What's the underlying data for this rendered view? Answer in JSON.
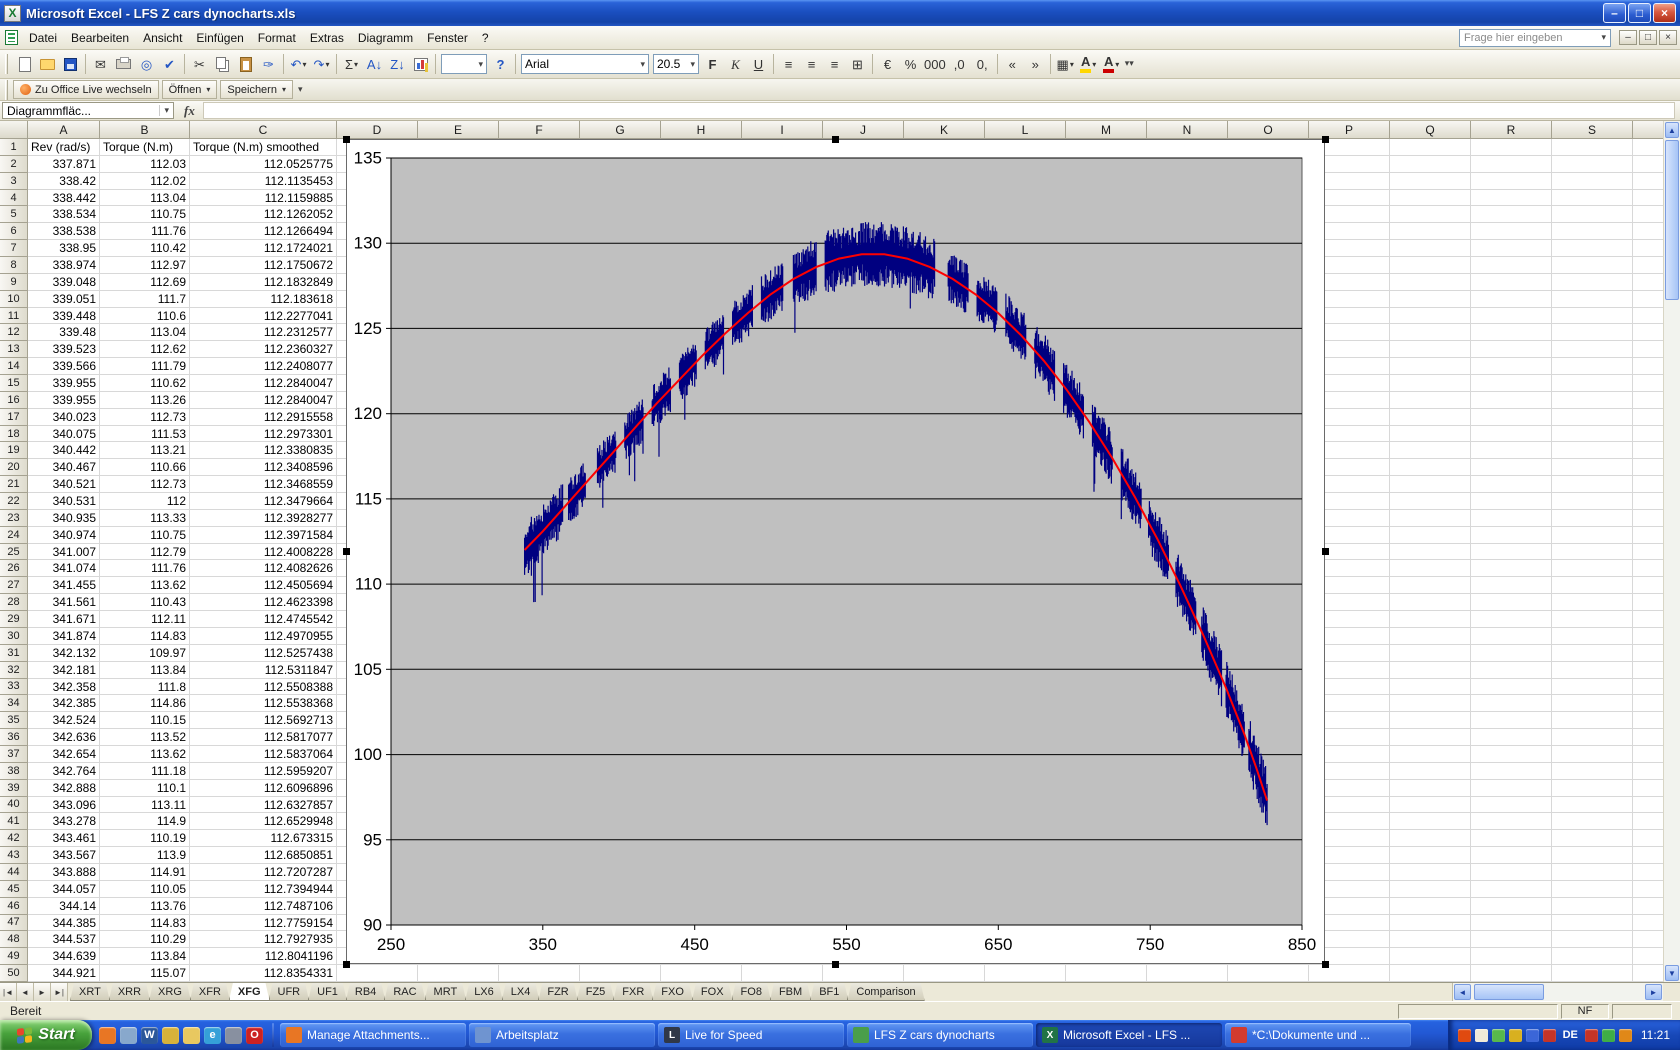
{
  "window": {
    "title": "Microsoft Excel - LFS Z cars dynocharts.xls",
    "min": "–",
    "max": "□",
    "close": "×"
  },
  "icons": {
    "excel_x": "X"
  },
  "ui": {
    "dd": "▾",
    "up": "▲",
    "down": "▼",
    "left": "◄",
    "right": "►"
  },
  "menu": {
    "items": [
      "Datei",
      "Bearbeiten",
      "Ansicht",
      "Einfügen",
      "Format",
      "Extras",
      "Diagramm",
      "Fenster",
      "?"
    ],
    "question_box": "Frage hier eingeben"
  },
  "toolbar_std": [
    {
      "name": "new-icon",
      "kind": "page"
    },
    {
      "name": "open-icon",
      "kind": "folder"
    },
    {
      "name": "save-icon",
      "kind": "disk"
    },
    {
      "sep": true
    },
    {
      "name": "email-icon",
      "glyph": "✉"
    },
    {
      "name": "print-icon",
      "kind": "print"
    },
    {
      "name": "print-preview-icon",
      "glyph": "◎",
      "cls": "c-blue"
    },
    {
      "name": "spelling-icon",
      "glyph": "✔",
      "cls": "c-blue"
    },
    {
      "sep": true
    },
    {
      "name": "cut-icon",
      "glyph": "✂"
    },
    {
      "name": "copy-icon",
      "kind": "copy"
    },
    {
      "name": "paste-icon",
      "kind": "paste"
    },
    {
      "name": "format-painter-icon",
      "glyph": "✑",
      "cls": "c-blue"
    },
    {
      "sep": true
    },
    {
      "name": "undo-icon",
      "glyph": "↶",
      "cls": "c-blue",
      "dd": true
    },
    {
      "name": "redo-icon",
      "glyph": "↷",
      "cls": "c-blue",
      "dd": true
    },
    {
      "sep": true
    },
    {
      "name": "autosum-icon",
      "glyph": "Σ",
      "dd": true
    },
    {
      "name": "sort-ascending-icon",
      "glyph": "A↓",
      "cls": "c-blue"
    },
    {
      "name": "sort-descending-icon",
      "glyph": "Z↓",
      "cls": "c-blue"
    },
    {
      "name": "chart-wizard-icon",
      "kind": "chart"
    },
    {
      "sep": true
    },
    {
      "name": "zoom-combo",
      "combo": ""
    },
    {
      "name": "help-icon",
      "glyph": "?",
      "cls": "c-blue s-b"
    }
  ],
  "toolbar_fmt": {
    "font_name": "Arial",
    "font_size": "20.5",
    "buttons": [
      {
        "name": "bold-button",
        "glyph": "F",
        "cls": "s-b"
      },
      {
        "name": "italic-button",
        "glyph": "K",
        "cls": "s-i"
      },
      {
        "name": "underline-button",
        "glyph": "U",
        "cls": "s-u"
      },
      {
        "sep": true
      },
      {
        "name": "align-left-icon",
        "glyph": "≡"
      },
      {
        "name": "align-center-icon",
        "glyph": "≡"
      },
      {
        "name": "align-right-icon",
        "glyph": "≡"
      },
      {
        "name": "merge-center-icon",
        "glyph": "⊞"
      },
      {
        "sep": true
      },
      {
        "name": "currency-icon",
        "glyph": "€"
      },
      {
        "name": "percent-icon",
        "glyph": "%"
      },
      {
        "name": "thousands-icon",
        "glyph": "000"
      },
      {
        "name": "increase-decimal-icon",
        "glyph": ",0"
      },
      {
        "name": "decrease-decimal-icon",
        "glyph": "0,"
      },
      {
        "sep": true
      },
      {
        "name": "decrease-indent-icon",
        "glyph": "«"
      },
      {
        "name": "increase-indent-icon",
        "glyph": "»"
      },
      {
        "sep": true
      },
      {
        "name": "borders-icon",
        "glyph": "▦",
        "dd": true
      },
      {
        "name": "fill-color-icon",
        "glyph": "A",
        "chip": "#ffd700",
        "dd": true
      },
      {
        "name": "font-color-icon",
        "glyph": "A",
        "chip": "#cc0000",
        "dd": true
      }
    ]
  },
  "office_bar": {
    "items": [
      {
        "name": "office-live-button",
        "label": "Zu Office Live wechseln",
        "icon": true
      },
      {
        "name": "open-menu-button",
        "label": "Öffnen",
        "dd": true
      },
      {
        "name": "save-menu-button",
        "label": "Speichern",
        "dd": true
      }
    ]
  },
  "formula_bar": {
    "name_box": "Diagrammfläc...",
    "fx": "fx",
    "formula": ""
  },
  "sheet": {
    "columns": [
      "A",
      "B",
      "C",
      "D",
      "E",
      "F",
      "G",
      "H",
      "I",
      "J",
      "K",
      "L",
      "M",
      "N",
      "O",
      "P",
      "Q",
      "R",
      "S"
    ],
    "first_row": [
      "Rev (rad/s)",
      "Torque (N.m)",
      "Torque (N.m) smoothed"
    ],
    "rows": [
      [
        "337.871",
        "112.03",
        "112.0525775"
      ],
      [
        "338.42",
        "112.02",
        "112.1135453"
      ],
      [
        "338.442",
        "113.04",
        "112.1159885"
      ],
      [
        "338.534",
        "110.75",
        "112.1262052"
      ],
      [
        "338.538",
        "111.76",
        "112.1266494"
      ],
      [
        "338.95",
        "110.42",
        "112.1724021"
      ],
      [
        "338.974",
        "112.97",
        "112.1750672"
      ],
      [
        "339.048",
        "112.69",
        "112.1832849"
      ],
      [
        "339.051",
        "111.7",
        "112.183618"
      ],
      [
        "339.448",
        "110.6",
        "112.2277041"
      ],
      [
        "339.48",
        "113.04",
        "112.2312577"
      ],
      [
        "339.523",
        "112.62",
        "112.2360327"
      ],
      [
        "339.566",
        "111.79",
        "112.2408077"
      ],
      [
        "339.955",
        "110.62",
        "112.2840047"
      ],
      [
        "339.955",
        "113.26",
        "112.2840047"
      ],
      [
        "340.023",
        "112.73",
        "112.2915558"
      ],
      [
        "340.075",
        "111.53",
        "112.2973301"
      ],
      [
        "340.442",
        "113.21",
        "112.3380835"
      ],
      [
        "340.467",
        "110.66",
        "112.3408596"
      ],
      [
        "340.521",
        "112.73",
        "112.3468559"
      ],
      [
        "340.531",
        "112",
        "112.3479664"
      ],
      [
        "340.935",
        "113.33",
        "112.3928277"
      ],
      [
        "340.974",
        "110.75",
        "112.3971584"
      ],
      [
        "341.007",
        "112.79",
        "112.4008228"
      ],
      [
        "341.074",
        "111.76",
        "112.4082626"
      ],
      [
        "341.455",
        "113.62",
        "112.4505694"
      ],
      [
        "341.561",
        "110.43",
        "112.4623398"
      ],
      [
        "341.671",
        "112.11",
        "112.4745542"
      ],
      [
        "341.874",
        "114.83",
        "112.4970955"
      ],
      [
        "342.132",
        "109.97",
        "112.5257438"
      ],
      [
        "342.181",
        "113.84",
        "112.5311847"
      ],
      [
        "342.358",
        "111.8",
        "112.5508388"
      ],
      [
        "342.385",
        "114.86",
        "112.5538368"
      ],
      [
        "342.524",
        "110.15",
        "112.5692713"
      ],
      [
        "342.636",
        "113.52",
        "112.5817077"
      ],
      [
        "342.654",
        "113.62",
        "112.5837064"
      ],
      [
        "342.764",
        "111.18",
        "112.5959207"
      ],
      [
        "342.888",
        "110.1",
        "112.6096896"
      ],
      [
        "343.096",
        "113.11",
        "112.6327857"
      ],
      [
        "343.278",
        "114.9",
        "112.6529948"
      ],
      [
        "343.461",
        "110.19",
        "112.673315"
      ],
      [
        "343.567",
        "113.9",
        "112.6850851"
      ],
      [
        "343.888",
        "114.91",
        "112.7207287"
      ],
      [
        "344.057",
        "110.05",
        "112.7394944"
      ],
      [
        "344.14",
        "113.76",
        "112.7487106"
      ],
      [
        "344.385",
        "114.83",
        "112.7759154"
      ],
      [
        "344.537",
        "110.29",
        "112.7927935"
      ],
      [
        "344.639",
        "113.84",
        "112.8041196"
      ],
      [
        "344.921",
        "115.07",
        "112.8354331"
      ]
    ]
  },
  "chart_data": {
    "type": "scatter",
    "title": "",
    "xlabel": "",
    "ylabel": "",
    "xlim": [
      250,
      850
    ],
    "ylim": [
      90,
      135
    ],
    "x_ticks": [
      250,
      350,
      450,
      550,
      650,
      750,
      850
    ],
    "y_ticks": [
      90,
      95,
      100,
      105,
      110,
      115,
      120,
      125,
      130,
      135
    ],
    "plot_bg": "#c0c0c0",
    "grid": true,
    "legend": false,
    "series": [
      {
        "name": "Torque (N.m)",
        "color": "#000080",
        "style": "noisy-vertical-bursts",
        "clusters": [
          [
            338,
            363,
            1.6
          ],
          [
            367,
            378,
            1.4
          ],
          [
            386,
            398,
            1.4
          ],
          [
            404,
            416,
            1.4
          ],
          [
            422,
            434,
            1.4
          ],
          [
            440,
            451,
            1.4
          ],
          [
            457,
            469,
            1.4
          ],
          [
            475,
            488,
            1.5
          ],
          [
            494,
            508,
            1.5
          ],
          [
            515,
            530,
            1.7
          ],
          [
            536,
            608,
            1.9
          ],
          [
            617,
            630,
            1.5
          ],
          [
            636,
            649,
            1.5
          ],
          [
            655,
            668,
            1.6
          ],
          [
            674,
            687,
            1.6
          ],
          [
            693,
            706,
            1.6
          ],
          [
            712,
            725,
            1.6
          ],
          [
            731,
            744,
            1.6
          ],
          [
            749,
            762,
            1.6
          ],
          [
            767,
            780,
            1.7
          ],
          [
            784,
            797,
            1.7
          ],
          [
            800,
            812,
            1.7
          ],
          [
            815,
            827,
            1.8
          ]
        ]
      },
      {
        "name": "Torque (N.m) smoothed",
        "color": "#ff0000",
        "style": "smooth-line",
        "points": [
          [
            338,
            112.0
          ],
          [
            350,
            113.1
          ],
          [
            365,
            114.6
          ],
          [
            380,
            116.1
          ],
          [
            395,
            117.6
          ],
          [
            410,
            119.1
          ],
          [
            425,
            120.6
          ],
          [
            440,
            122.0
          ],
          [
            455,
            123.4
          ],
          [
            470,
            124.7
          ],
          [
            485,
            125.9
          ],
          [
            500,
            127.0
          ],
          [
            515,
            127.9
          ],
          [
            530,
            128.6
          ],
          [
            545,
            129.1
          ],
          [
            560,
            129.35
          ],
          [
            575,
            129.35
          ],
          [
            590,
            129.1
          ],
          [
            605,
            128.6
          ],
          [
            620,
            127.9
          ],
          [
            635,
            127.0
          ],
          [
            650,
            125.9
          ],
          [
            665,
            124.6
          ],
          [
            680,
            123.1
          ],
          [
            695,
            121.4
          ],
          [
            710,
            119.5
          ],
          [
            725,
            117.4
          ],
          [
            740,
            115.1
          ],
          [
            755,
            112.6
          ],
          [
            770,
            109.9
          ],
          [
            785,
            107.0
          ],
          [
            800,
            103.9
          ],
          [
            812,
            101.2
          ],
          [
            820,
            99.2
          ],
          [
            827,
            97.3
          ]
        ]
      }
    ]
  },
  "tabs": {
    "nav": [
      "|◄",
      "◄",
      "►",
      "►|"
    ],
    "sheets": [
      "XRT",
      "XRR",
      "XRG",
      "XFR",
      "XFG",
      "UFR",
      "UF1",
      "RB4",
      "RAC",
      "MRT",
      "LX6",
      "LX4",
      "FZR",
      "FZ5",
      "FXR",
      "FXO",
      "FOX",
      "FO8",
      "FBM",
      "BF1",
      "Comparison"
    ],
    "active": "XFG"
  },
  "status_bar": {
    "left": "Bereit",
    "right": "NF"
  },
  "taskbar": {
    "start": "Start",
    "quick_launch": [
      {
        "name": "quicklaunch-browser",
        "color": "#e87624",
        "glyph": ""
      },
      {
        "name": "quicklaunch-show-desktop",
        "color": "#88a8cc",
        "glyph": ""
      },
      {
        "name": "quicklaunch-word",
        "color": "#2b579a",
        "glyph": "W"
      },
      {
        "name": "quicklaunch-keys",
        "color": "#d8b23a",
        "glyph": ""
      },
      {
        "name": "quicklaunch-folder",
        "color": "#e8c860",
        "glyph": ""
      },
      {
        "name": "quicklaunch-ie",
        "color": "#35a0d8",
        "glyph": "e"
      },
      {
        "name": "quicklaunch-mail",
        "color": "#8890a0",
        "glyph": ""
      },
      {
        "name": "quicklaunch-opera",
        "color": "#cc2222",
        "glyph": "O"
      }
    ],
    "buttons": [
      {
        "label": "Manage Attachments...",
        "icon": "attachment",
        "color": "#e87624",
        "glyph": ""
      },
      {
        "label": "Arbeitsplatz",
        "icon": "computer",
        "color": "#6f94d0",
        "glyph": ""
      },
      {
        "label": "Live for Speed",
        "icon": "game",
        "color": "#303848",
        "glyph": "L"
      },
      {
        "label": "LFS Z cars dynocharts",
        "icon": "chart",
        "color": "#4a9e4a",
        "glyph": ""
      },
      {
        "label": "Microsoft Excel - LFS ...",
        "icon": "excel",
        "color": "#217346",
        "glyph": "X",
        "active": true
      },
      {
        "label": "*C:\\Dokumente und ...",
        "icon": "notepad",
        "color": "#d23b2f",
        "glyph": ""
      }
    ],
    "tray_left": [
      "#e04a10",
      "#f0ead8",
      "#58b84c",
      "#d8b020",
      "#3b66d8",
      "#c43428"
    ],
    "language": "DE",
    "tray_right": [
      "#c43428",
      "#3fae46",
      "#e08818"
    ],
    "clock": "11:21"
  }
}
